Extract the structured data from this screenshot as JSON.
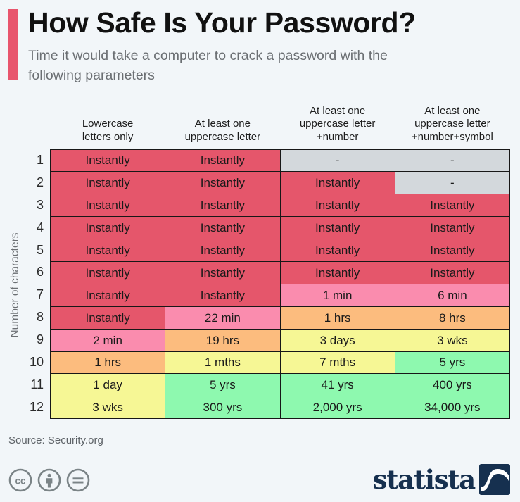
{
  "header": {
    "title": "How Safe Is Your Password?",
    "subtitle": "Time it would take a computer to crack a password with the following parameters",
    "accent_color": "#e8556d"
  },
  "axis": {
    "y_caption": "Number of characters"
  },
  "footer": {
    "source": "Source: Security.org",
    "brand": "statista",
    "cc_icons": [
      "cc-icon",
      "cc-by-person-icon",
      "cc-nd-equals-icon"
    ],
    "brand_color": "#16304f"
  },
  "legend_colors": {
    "red": "#e5566b",
    "pink": "#fa8cae",
    "orange": "#fcbc7e",
    "yellow": "#f6f795",
    "green": "#8ef9af",
    "gray": "#d3d8dc",
    "background": "#f2f6f9"
  },
  "chart_data": {
    "type": "heatmap",
    "title": "How Safe Is Your Password?",
    "subtitle": "Time it would take a computer to crack a password with the following parameters",
    "xlabel": "",
    "ylabel": "Number of characters",
    "grid": true,
    "legend_position": "none",
    "columns": [
      "Lowercase letters only",
      "At least one uppercase letter",
      "At least one uppercase letter +number",
      "At least one uppercase letter +number+symbol"
    ],
    "column_lines": [
      [
        "Lowercase",
        "letters only"
      ],
      [
        "At least one",
        "uppercase letter"
      ],
      [
        "At least one",
        "uppercase letter",
        "+number"
      ],
      [
        "At least one",
        "uppercase letter",
        "+number+symbol"
      ]
    ],
    "row_labels": [
      "1",
      "2",
      "3",
      "4",
      "5",
      "6",
      "7",
      "8",
      "9",
      "10",
      "11",
      "12"
    ],
    "rows": [
      {
        "label": "1",
        "cells": [
          {
            "value": "Instantly",
            "color": "red"
          },
          {
            "value": "Instantly",
            "color": "red"
          },
          {
            "value": "-",
            "color": "gray"
          },
          {
            "value": "-",
            "color": "gray"
          }
        ]
      },
      {
        "label": "2",
        "cells": [
          {
            "value": "Instantly",
            "color": "red"
          },
          {
            "value": "Instantly",
            "color": "red"
          },
          {
            "value": "Instantly",
            "color": "red"
          },
          {
            "value": "-",
            "color": "gray"
          }
        ]
      },
      {
        "label": "3",
        "cells": [
          {
            "value": "Instantly",
            "color": "red"
          },
          {
            "value": "Instantly",
            "color": "red"
          },
          {
            "value": "Instantly",
            "color": "red"
          },
          {
            "value": "Instantly",
            "color": "red"
          }
        ]
      },
      {
        "label": "4",
        "cells": [
          {
            "value": "Instantly",
            "color": "red"
          },
          {
            "value": "Instantly",
            "color": "red"
          },
          {
            "value": "Instantly",
            "color": "red"
          },
          {
            "value": "Instantly",
            "color": "red"
          }
        ]
      },
      {
        "label": "5",
        "cells": [
          {
            "value": "Instantly",
            "color": "red"
          },
          {
            "value": "Instantly",
            "color": "red"
          },
          {
            "value": "Instantly",
            "color": "red"
          },
          {
            "value": "Instantly",
            "color": "red"
          }
        ]
      },
      {
        "label": "6",
        "cells": [
          {
            "value": "Instantly",
            "color": "red"
          },
          {
            "value": "Instantly",
            "color": "red"
          },
          {
            "value": "Instantly",
            "color": "red"
          },
          {
            "value": "Instantly",
            "color": "red"
          }
        ]
      },
      {
        "label": "7",
        "cells": [
          {
            "value": "Instantly",
            "color": "red"
          },
          {
            "value": "Instantly",
            "color": "red"
          },
          {
            "value": "1 min",
            "color": "pink"
          },
          {
            "value": "6 min",
            "color": "pink"
          }
        ]
      },
      {
        "label": "8",
        "cells": [
          {
            "value": "Instantly",
            "color": "red"
          },
          {
            "value": "22 min",
            "color": "pink"
          },
          {
            "value": "1 hrs",
            "color": "orange"
          },
          {
            "value": "8 hrs",
            "color": "orange"
          }
        ]
      },
      {
        "label": "9",
        "cells": [
          {
            "value": "2 min",
            "color": "pink"
          },
          {
            "value": "19 hrs",
            "color": "orange"
          },
          {
            "value": "3 days",
            "color": "yellow"
          },
          {
            "value": "3 wks",
            "color": "yellow"
          }
        ]
      },
      {
        "label": "10",
        "cells": [
          {
            "value": "1 hrs",
            "color": "orange"
          },
          {
            "value": "1 mths",
            "color": "yellow"
          },
          {
            "value": "7 mths",
            "color": "yellow"
          },
          {
            "value": "5 yrs",
            "color": "green"
          }
        ]
      },
      {
        "label": "11",
        "cells": [
          {
            "value": "1 day",
            "color": "yellow"
          },
          {
            "value": "5 yrs",
            "color": "green"
          },
          {
            "value": "41 yrs",
            "color": "green"
          },
          {
            "value": "400 yrs",
            "color": "green"
          }
        ]
      },
      {
        "label": "12",
        "cells": [
          {
            "value": "3 wks",
            "color": "yellow"
          },
          {
            "value": "300 yrs",
            "color": "green"
          },
          {
            "value": "2,000 yrs",
            "color": "green"
          },
          {
            "value": "34,000 yrs",
            "color": "green"
          }
        ]
      }
    ]
  }
}
